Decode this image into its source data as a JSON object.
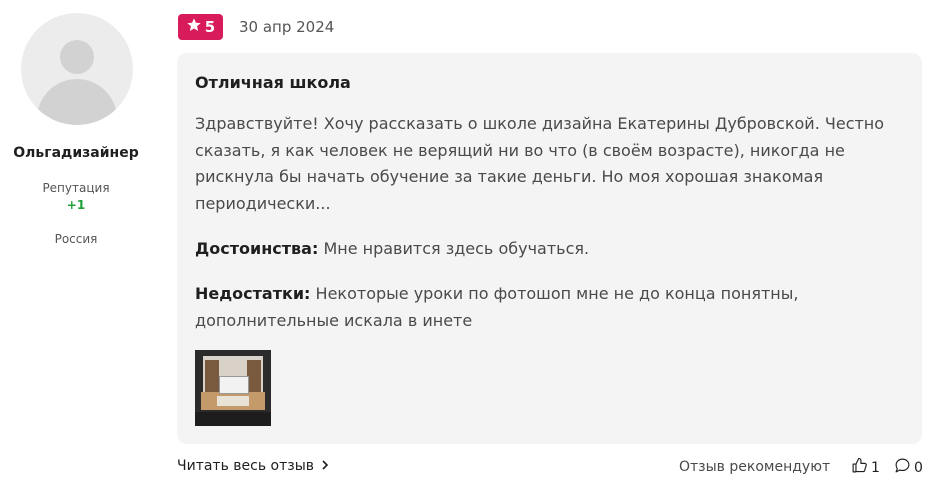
{
  "author": {
    "name": "Ольгадизайнер",
    "reputation_label": "Репутация",
    "reputation_value": "+1",
    "country": "Россия"
  },
  "review": {
    "rating": "5",
    "date": "30 апр 2024",
    "title": "Отличная школа",
    "text": "Здравствуйте! Хочу рассказать о школе дизайна Екатерины Дубровской. Честно сказать, я как человек не верящий ни во что (в своём возрасте), никогда не рискнула бы начать обучение за такие деньги. Но моя хорошая знакомая периодически...",
    "pros_label": "Достоинства:",
    "pros_text": "Мне нравится здесь обучаться.",
    "cons_label": "Недостатки:",
    "cons_text": "Некоторые уроки по фотошоп мне не до конца понятны, дополнительные искала в инете"
  },
  "footer": {
    "read_more": "Читать весь отзыв",
    "recommend_label": "Отзыв рекомендуют",
    "likes": "1",
    "comments": "0"
  },
  "icons": {
    "star": "star-icon",
    "chevron": "chevron-right-icon",
    "thumb": "thumbs-up-icon",
    "comment": "comment-icon"
  },
  "colors": {
    "rating_badge": "#d81b5b",
    "reputation_positive": "#21a038",
    "card_bg": "#f4f4f4"
  }
}
